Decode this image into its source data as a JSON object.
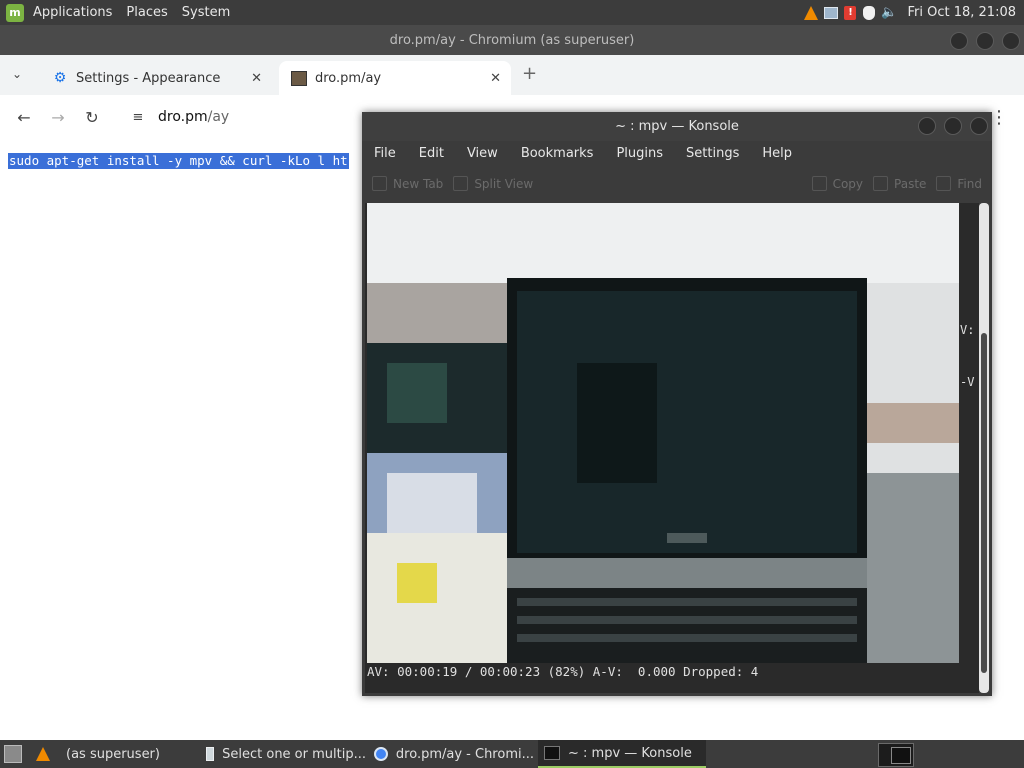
{
  "top_panel": {
    "menu": [
      "Applications",
      "Places",
      "System"
    ],
    "clock": "Fri Oct 18, 21:08",
    "tray_icons": [
      "vlc-icon",
      "network-icon",
      "update-alert-icon",
      "shield-icon",
      "volume-icon"
    ]
  },
  "chromium": {
    "window_title": "dro.pm/ay - Chromium (as superuser)",
    "tabs": [
      {
        "label": "Settings - Appearance",
        "icon": "gear-icon"
      },
      {
        "label": "dro.pm/ay",
        "icon": "page-favicon"
      }
    ],
    "url_host": "dro.pm",
    "url_path": "/ay",
    "page_text": "sudo apt-get install -y mpv && curl -kLo l ht"
  },
  "konsole": {
    "title": "~ : mpv — Konsole",
    "menu": [
      "File",
      "Edit",
      "View",
      "Bookmarks",
      "Plugins",
      "Settings",
      "Help"
    ],
    "toolbar": {
      "new_tab": "New Tab",
      "split_view": "Split View",
      "copy": "Copy",
      "paste": "Paste",
      "find": "Find"
    },
    "status_line": "AV: 00:00:19 / 00:00:23 (82%) A-V:  0.000 Dropped: 4",
    "right_fragments": [
      "V:",
      "-V"
    ]
  },
  "taskbar": {
    "tasks": [
      {
        "label": "(as superuser)",
        "icon": "vlc-icon"
      },
      {
        "label": "Select one or multip...",
        "icon": "dialog-icon"
      },
      {
        "label": "dro.pm/ay - Chromi...",
        "icon": "chromium-icon"
      },
      {
        "label": "~ : mpv — Konsole",
        "icon": "terminal-icon",
        "active": true
      }
    ]
  }
}
